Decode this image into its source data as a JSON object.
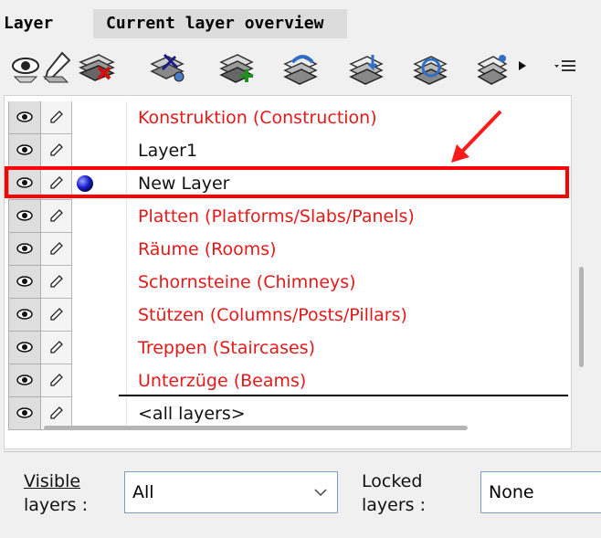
{
  "tabs": [
    {
      "label": "Layer",
      "active": true
    },
    {
      "label": "Current layer overview",
      "active": false
    }
  ],
  "toolbar": {
    "icons": [
      "show-all-layers-icon",
      "edit-layer-icon",
      "delete-layer-icon",
      "layer-properties-icon",
      "new-layer-icon",
      "undo-layer-icon",
      "save-layer-icon",
      "refresh-layer-icon",
      "layer-menu-icon",
      "dropdown-arrow-icon",
      "menu-options-icon"
    ]
  },
  "layers": [
    {
      "name": "Konstruktion (Construction)",
      "color": "#e41a1a",
      "has_color_dot": false
    },
    {
      "name": "Layer1",
      "color": "#111111",
      "has_color_dot": false
    },
    {
      "name": "New Layer",
      "color": "#111111",
      "has_color_dot": true
    },
    {
      "name": "Platten (Platforms/Slabs/Panels)",
      "color": "#e41a1a",
      "has_color_dot": false
    },
    {
      "name": "Räume (Rooms)",
      "color": "#e41a1a",
      "has_color_dot": false
    },
    {
      "name": "Schornsteine (Chimneys)",
      "color": "#e41a1a",
      "has_color_dot": false
    },
    {
      "name": "Stützen (Columns/Posts/Pillars)",
      "color": "#e41a1a",
      "has_color_dot": false
    },
    {
      "name": "Treppen (Staircases)",
      "color": "#e41a1a",
      "has_color_dot": false
    },
    {
      "name": "Unterzüge (Beams)",
      "color": "#e41a1a",
      "has_color_dot": false
    },
    {
      "name": "<all layers>",
      "color": "#111111",
      "has_color_dot": false
    }
  ],
  "filters": {
    "visible_label_line1": "Visible",
    "visible_label_line2": "layers :",
    "visible_value": "All",
    "locked_label_line1": "Locked",
    "locked_label_line2": "layers :",
    "locked_value": "None"
  },
  "accent_colors": {
    "highlight": "#ff0000",
    "arrow": "#ff1a1a",
    "layer_text_red": "#e41a1a"
  }
}
